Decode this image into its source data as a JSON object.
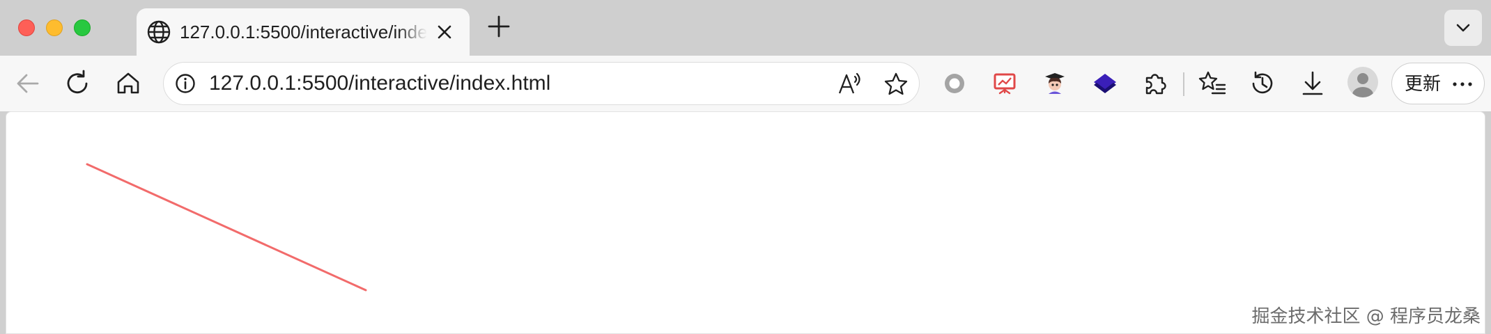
{
  "browser": {
    "tab": {
      "title": "127.0.0.1:5500/interactive/index.html",
      "favicon": "globe-icon"
    },
    "address_bar": {
      "url": "127.0.0.1:5500/interactive/index.html"
    },
    "toolbar": {
      "update_label": "更新"
    },
    "icons": [
      "back-icon",
      "reload-icon",
      "home-icon",
      "info-icon",
      "read-aloud-icon",
      "favorite-star-icon",
      "record-circle-icon",
      "presentation-extension-icon",
      "avatar-extension-icon",
      "layers-extension-icon",
      "extensions-puzzle-icon",
      "favorites-icon",
      "history-icon",
      "downloads-icon",
      "profile-avatar-icon",
      "more-icon"
    ]
  },
  "page": {
    "line_color": "#f26b6b",
    "watermark": "掘金技术社区 @ 程序员龙桑"
  }
}
